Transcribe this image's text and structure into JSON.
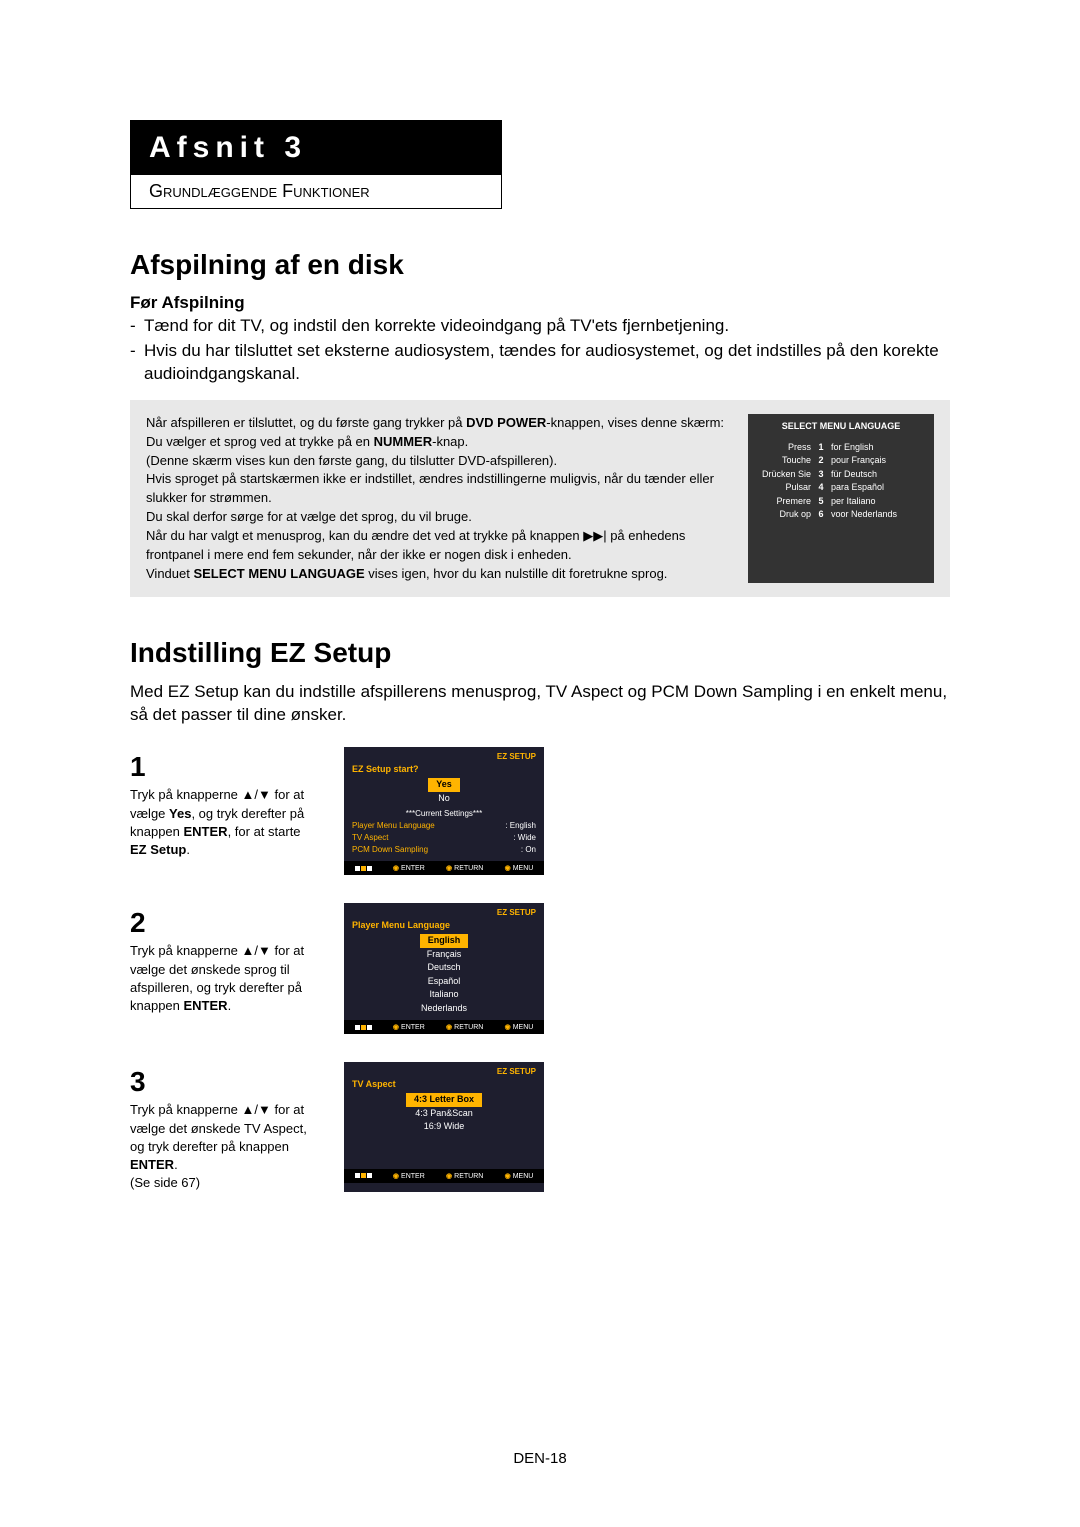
{
  "section": {
    "title": "Afsnit 3",
    "subtitle": "Grundlæggende Funktioner"
  },
  "h1a": "Afspilning af en disk",
  "h2a": "Før Afspilning",
  "bullets": {
    "b1": "Tænd for dit TV, og indstil den korrekte videoindgang på TV'ets fjernbetjening.",
    "b2": "Hvis du har tilsluttet set eksterne audiosystem, tændes for audiosystemet, og det indstilles på den korekte audioindgangskanal."
  },
  "gray": {
    "p1a": "Når afspilleren er tilsluttet, og du første gang trykker på ",
    "p1b": "DVD POWER",
    "p1c": "-knappen, vises denne skærm: Du vælger et sprog ved at trykke på en ",
    "p1d": "NUMMER",
    "p1e": "-knap.",
    "p2": "(Denne skærm vises kun den første gang, du tilslutter DVD-afspilleren).",
    "p3": "Hvis sproget på startskærmen ikke er indstillet, ændres indstillingerne muligvis, når du tænder eller slukker for strømmen.",
    "p4": "Du skal derfor sørge for at vælge det sprog, du vil bruge.",
    "p5a": "Når du har valgt et menusprog, kan du ændre det ved at trykke på knappen ",
    "p5b": " på enhedens frontpanel i mere end fem sekunder, når der ikke er nogen disk i enheden.",
    "p6a": "Vinduet ",
    "p6b": "SELECT MENU LANGUAGE",
    "p6c": " vises igen, hvor du kan nulstille dit foretrukne sprog."
  },
  "langmenu": {
    "title": "SELECT MENU LANGUAGE",
    "rows": [
      {
        "l": "Press",
        "n": "1",
        "r": "for English"
      },
      {
        "l": "Touche",
        "n": "2",
        "r": "pour Français"
      },
      {
        "l": "Drücken Sie",
        "n": "3",
        "r": "für Deutsch"
      },
      {
        "l": "Pulsar",
        "n": "4",
        "r": "para Español"
      },
      {
        "l": "Premere",
        "n": "5",
        "r": "per Italiano"
      },
      {
        "l": "Druk op",
        "n": "6",
        "r": "voor Nederlands"
      }
    ]
  },
  "h1b": "Indstilling EZ Setup",
  "ezintro": "Med EZ Setup kan du indstille afspillerens menusprog, TV Aspect og PCM Down Sampling i en enkelt menu, så det passer til dine ønsker.",
  "steps": {
    "s1": {
      "num": "1",
      "t1": "Tryk på knapperne ▲/▼ for at vælge ",
      "t2": "Yes",
      "t3": ", og tryk derefter på knappen ",
      "t4": "ENTER",
      "t5": ", for at starte ",
      "t6": "EZ Setup",
      "t7": "."
    },
    "s2": {
      "num": "2",
      "t1": "Tryk på knapperne ▲/▼ for at vælge det ønskede sprog til afspilleren, og tryk derefter på knappen ",
      "t2": "ENTER",
      "t3": "."
    },
    "s3": {
      "num": "3",
      "t1": "Tryk på knapperne ▲/▼ for at vælge det ønskede TV Aspect, og tryk derefter på knappen ",
      "t2": "ENTER",
      "t3": ".",
      "t4": "(Se side 67)"
    }
  },
  "ez": {
    "header": "EZ SETUP",
    "q": "EZ Setup start?",
    "yes": "Yes",
    "no": "No",
    "cur": "***Current Settings***",
    "r1l": "Player Menu Language",
    "r1v": ": English",
    "r2l": "TV Aspect",
    "r2v": ": Wide",
    "r3l": "PCM Down Sampling",
    "r3v": ": On",
    "pml": "Player Menu Language",
    "langs": [
      "English",
      "Français",
      "Deutsch",
      "Español",
      "Italiano",
      "Nederlands"
    ],
    "tva": "TV Aspect",
    "aspects": [
      "4:3 Letter Box",
      "4:3 Pan&Scan",
      "16:9 Wide"
    ],
    "fEnter": "ENTER",
    "fReturn": "RETURN",
    "fMenu": "MENU"
  },
  "pagenum": "DEN-18"
}
